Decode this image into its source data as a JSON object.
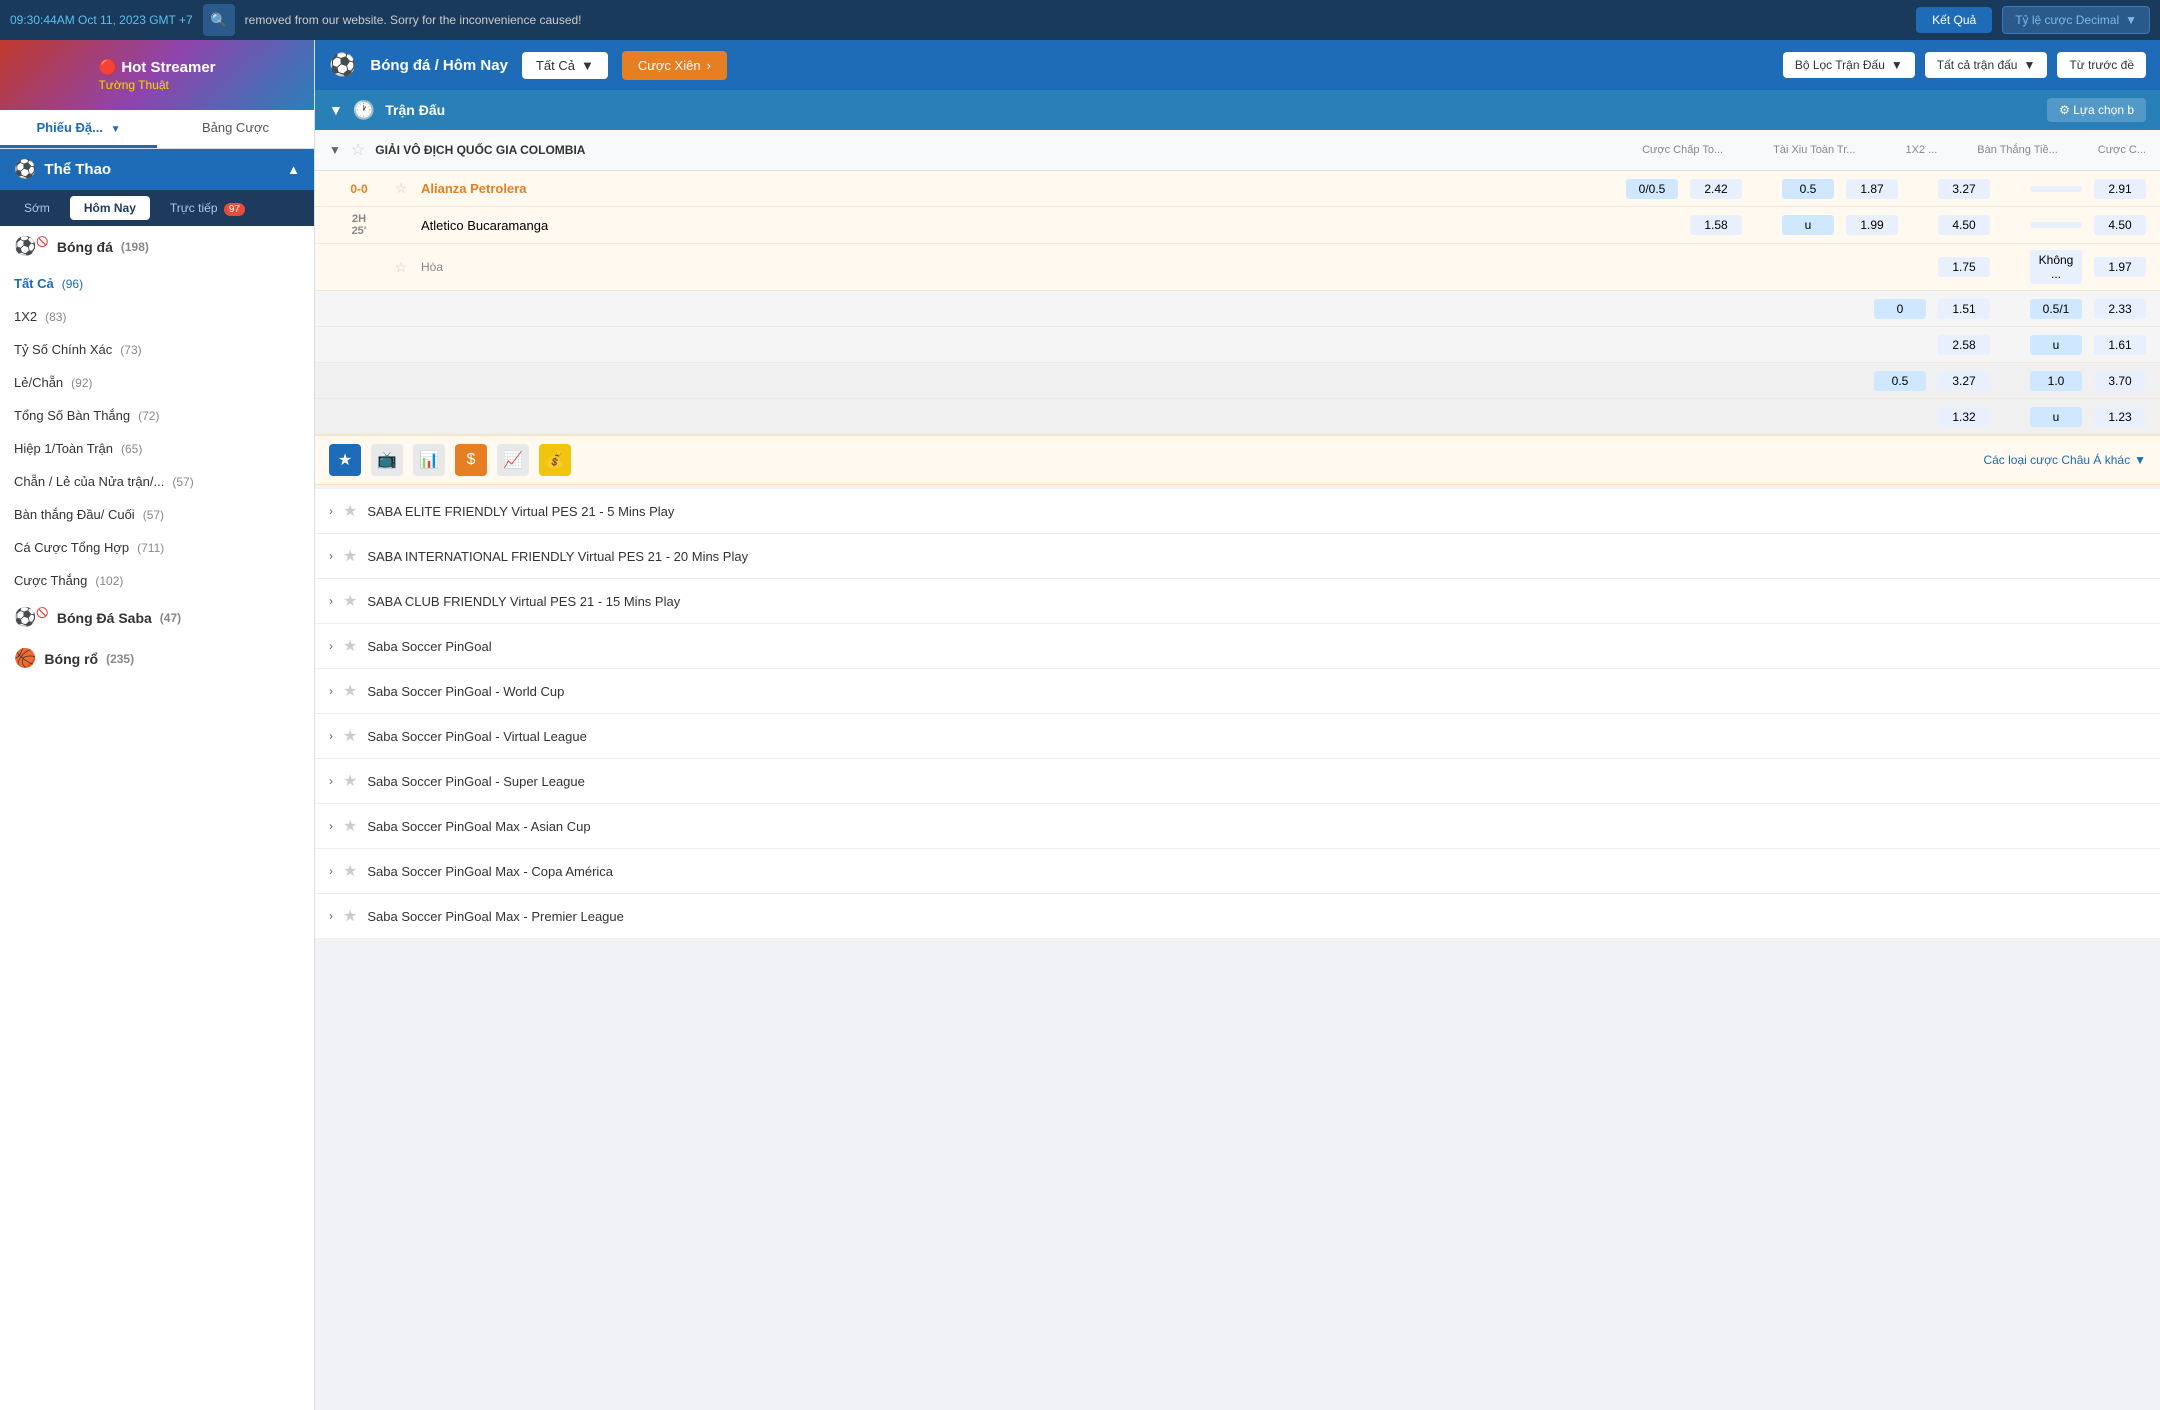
{
  "topbar": {
    "datetime": "09:30:44AM Oct 11, 2023 GMT +7",
    "notice": "removed from our website. Sorry for the inconvenience caused!",
    "ket_qua": "Kết Quả",
    "ty_le_label": "Tỷ lệ cược Decimal"
  },
  "sidebar": {
    "banner_line1": "Hot Streamer",
    "banner_line2": "Tường Thuật",
    "tab1": "Phiếu Đặ...",
    "tab2": "Bảng Cược",
    "the_thao": "Thể Thao",
    "nav": {
      "som": "Sớm",
      "hom_nay": "Hôm Nay",
      "truc_tiep": "Trực tiếp",
      "badge": "97"
    },
    "sports": [
      {
        "name": "Bóng đá",
        "count": "(198)",
        "icon": "⚽",
        "type": "soccer"
      },
      {
        "name": "Tất Cả",
        "count": "(96)",
        "active": true
      },
      {
        "name": "1X2",
        "count": "(83)"
      },
      {
        "name": "Tỷ Số Chính Xác",
        "count": "(73)"
      },
      {
        "name": "Lẻ/Chẵn",
        "count": "(92)"
      },
      {
        "name": "Tổng Số Bàn Thắng",
        "count": "(72)"
      },
      {
        "name": "Hiệp 1/Toàn Trận",
        "count": "(65)"
      },
      {
        "name": "Chẵn / Lẻ của Nửa trận/...",
        "count": "(57)"
      },
      {
        "name": "Bàn thắng Đầu/ Cuối",
        "count": "(57)"
      },
      {
        "name": "Cá Cược Tổng Hợp",
        "count": "(711)"
      },
      {
        "name": "Cược Thắng",
        "count": "(102)"
      }
    ],
    "sports_bottom": [
      {
        "name": "Bóng Đá Saba",
        "count": "(47)",
        "icon": "⚽",
        "type": "saba"
      },
      {
        "name": "Bóng rổ",
        "count": "(235)",
        "icon": "🏀"
      }
    ]
  },
  "header": {
    "breadcrumb": "Bóng đá / Hôm Nay",
    "tat_ca": "Tất Cả",
    "cuoc_xien": "Cược Xiên",
    "bo_loc": "Bộ Lọc Trận Đấu",
    "tat_ca_tran": "Tất cả trận đấu",
    "tu_truoc_de": "Từ trước đề"
  },
  "tran_dau_bar": {
    "label": "Trận Đấu",
    "lua_chon": "Lựa chọn b"
  },
  "match": {
    "league": "GIẢI VÔ ĐỊCH QUỐC GIA COLOMBIA",
    "cols": {
      "cuoc_chap": "Cược Chấp To...",
      "tai_xiu": "Tài Xiu Toàn Tr...",
      "x1x2": "1X2 ...",
      "ban_thang": "Bàn Thắng Tiề...",
      "cuoc_c": "Cược C..."
    },
    "time": "0-0",
    "time2": "2H",
    "time3": "25'",
    "team1": "Alianza Petrolera",
    "team2": "Atletico Bucaramanga",
    "hoa": "Hòa",
    "odds": {
      "row1": {
        "chap": "0/0.5",
        "v1": "2.42",
        "taixiu": "0.5",
        "v2": "1.87",
        "x1x2": "3.27",
        "ban": "",
        "v3": "2.91"
      },
      "row2": {
        "chap": "",
        "v1": "1.58",
        "taixiu": "u",
        "v2": "1.99",
        "x1x2": "4.50",
        "ban": "",
        "v3": "4.50"
      },
      "row3": {
        "chap": "",
        "v1": "",
        "taixiu": "",
        "v2": "",
        "x1x2": "1.75",
        "ban": "Không ...",
        "v3": "1.97"
      },
      "row4": {
        "chap": "0",
        "v1": "1.51",
        "taixiu": "0.5/1",
        "v2": "2.33",
        "x1x2": "",
        "ban": "",
        "v3": ""
      },
      "row5": {
        "chap": "",
        "v1": "2.58",
        "taixiu": "u",
        "v2": "1.61",
        "x1x2": "",
        "ban": "",
        "v3": ""
      },
      "row6": {
        "chap": "0.5",
        "v1": "3.27",
        "taixiu": "1.0",
        "v2": "3.70",
        "x1x2": "",
        "ban": "",
        "v3": ""
      },
      "row7": {
        "chap": "",
        "v1": "1.32",
        "taixiu": "u",
        "v2": "1.23",
        "x1x2": "",
        "ban": "",
        "v3": ""
      }
    },
    "chau_a_label": "Các loại cược Châu Á khác"
  },
  "leagues": [
    "SABA ELITE FRIENDLY Virtual PES 21 - 5 Mins Play",
    "SABA INTERNATIONAL FRIENDLY Virtual PES 21 - 20 Mins Play",
    "SABA CLUB FRIENDLY Virtual PES 21 - 15 Mins Play",
    "Saba Soccer PinGoal",
    "Saba Soccer PinGoal - World Cup",
    "Saba Soccer PinGoal - Virtual League",
    "Saba Soccer PinGoal - Super League",
    "Saba Soccer PinGoal Max - Asian Cup",
    "Saba Soccer PinGoal Max - Copa América",
    "Saba Soccer PinGoal Max - Premier League"
  ]
}
